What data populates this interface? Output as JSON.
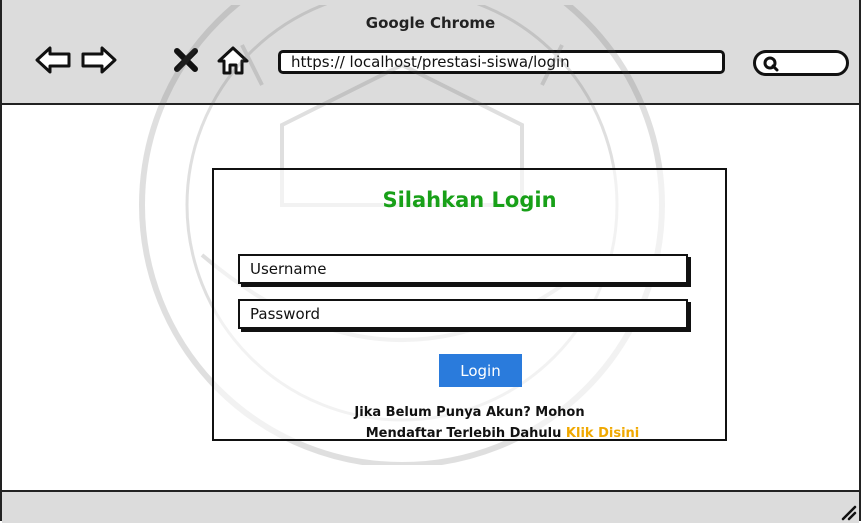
{
  "window": {
    "title": "Google Chrome"
  },
  "toolbar": {
    "back_icon": "back-arrow-icon",
    "forward_icon": "forward-arrow-icon",
    "stop_icon": "close-x-icon",
    "home_icon": "home-icon",
    "address": "https:// localhost/prestasi-siswa/login",
    "search_icon": "search-icon"
  },
  "login": {
    "title": "Silahkan Login",
    "username_placeholder": "Username",
    "password_placeholder": "Password",
    "button_label": "Login",
    "signup_line1": "Jika Belum Punya Akun? Mohon",
    "signup_line2": "Mendaftar Terlebih Dahulu",
    "signup_link": "Klik Disini"
  },
  "colors": {
    "title_green": "#18a018",
    "button_blue": "#2a7bdc",
    "link_orange": "#f0a800",
    "chrome_gray": "#dcdcdc"
  }
}
